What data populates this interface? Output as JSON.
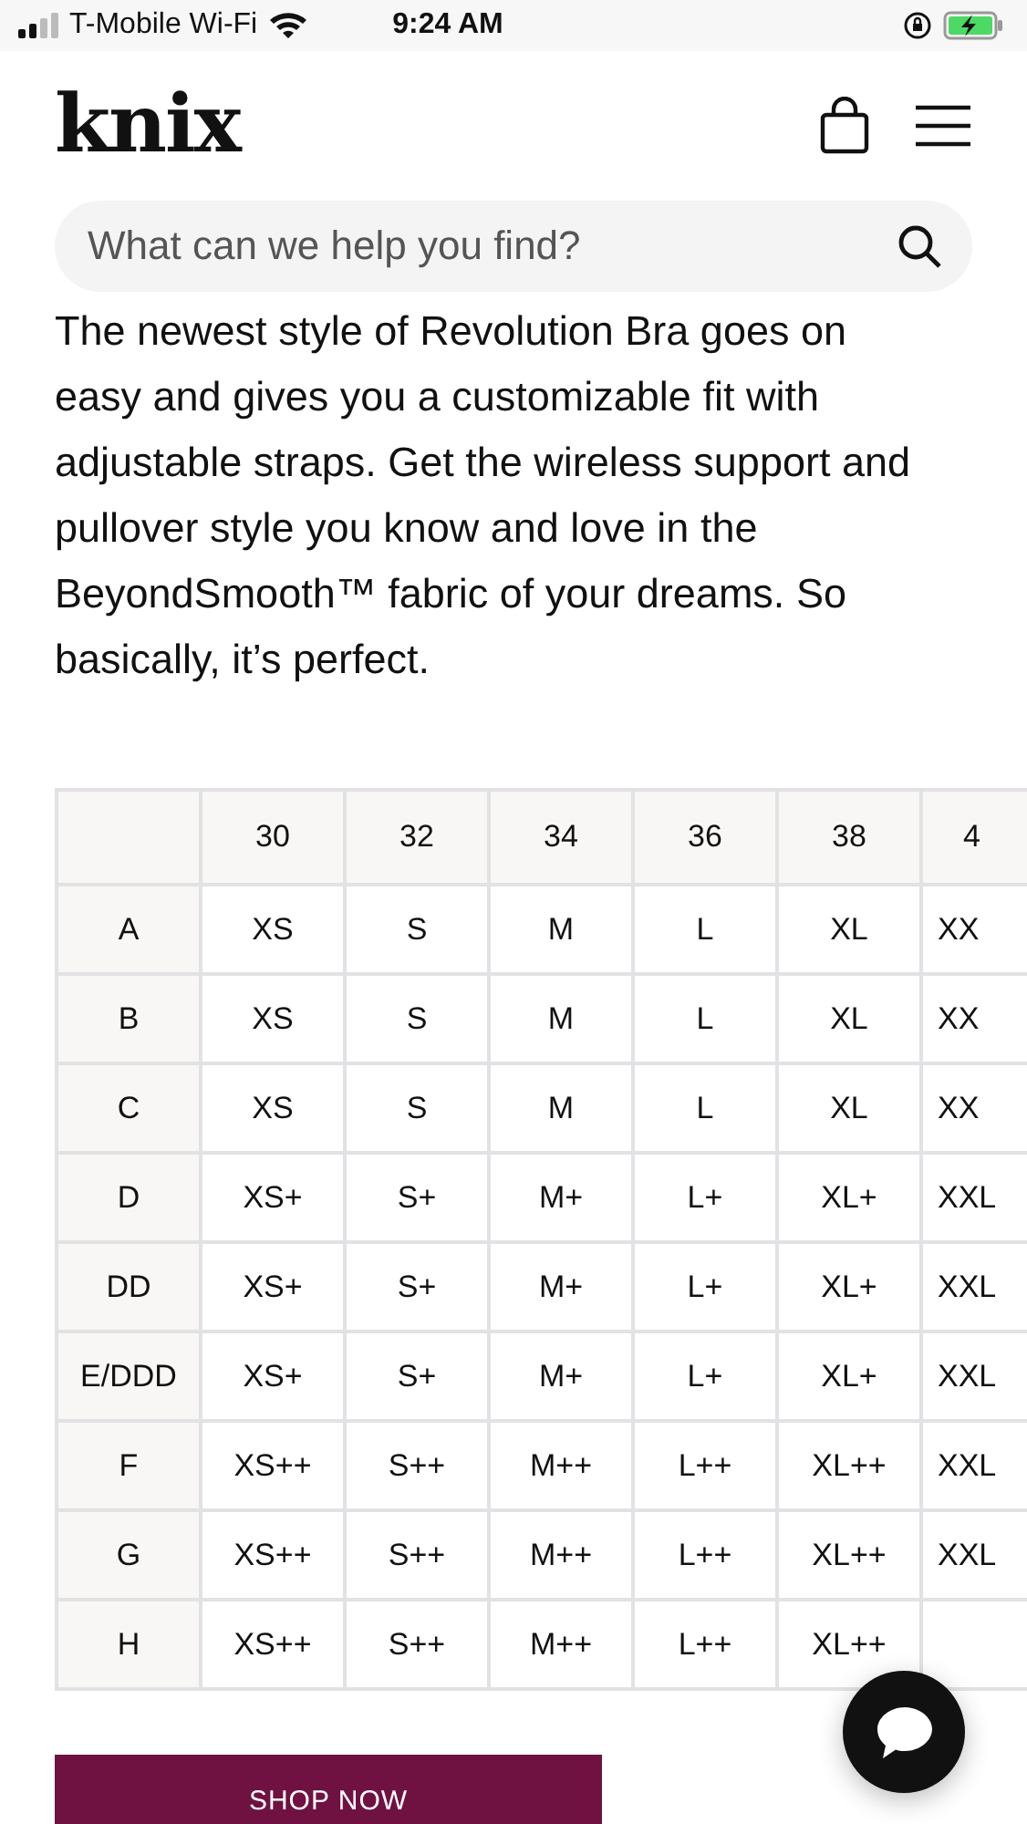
{
  "status_bar": {
    "carrier": "T-Mobile Wi-Fi",
    "time": "9:24 AM",
    "battery_charging": true
  },
  "header": {
    "logo": "knix"
  },
  "search": {
    "placeholder": "What can we help you find?"
  },
  "description": "The newest style of Revolution Bra goes on easy and gives you a customizable fit with adjustable straps. Get the wireless support and pullover style you know and love in the BeyondSmooth™ fabric of your dreams. So basically, it’s perfect.",
  "size_table": {
    "columns": [
      "30",
      "32",
      "34",
      "36",
      "38",
      "4"
    ],
    "rows": [
      {
        "label": "A",
        "cells": [
          "XS",
          "S",
          "M",
          "L",
          "XL",
          "XX"
        ]
      },
      {
        "label": "B",
        "cells": [
          "XS",
          "S",
          "M",
          "L",
          "XL",
          "XX"
        ]
      },
      {
        "label": "C",
        "cells": [
          "XS",
          "S",
          "M",
          "L",
          "XL",
          "XX"
        ]
      },
      {
        "label": "D",
        "cells": [
          "XS+",
          "S+",
          "M+",
          "L+",
          "XL+",
          "XXL"
        ]
      },
      {
        "label": "DD",
        "cells": [
          "XS+",
          "S+",
          "M+",
          "L+",
          "XL+",
          "XXL"
        ]
      },
      {
        "label": "E/DDD",
        "cells": [
          "XS+",
          "S+",
          "M+",
          "L+",
          "XL+",
          "XXL"
        ]
      },
      {
        "label": "F",
        "cells": [
          "XS++",
          "S++",
          "M++",
          "L++",
          "XL++",
          "XXL"
        ]
      },
      {
        "label": "G",
        "cells": [
          "XS++",
          "S++",
          "M++",
          "L++",
          "XL++",
          "XXL"
        ]
      },
      {
        "label": "H",
        "cells": [
          "XS++",
          "S++",
          "M++",
          "L++",
          "XL++"
        ]
      }
    ]
  },
  "shop_button": "SHOP NOW"
}
